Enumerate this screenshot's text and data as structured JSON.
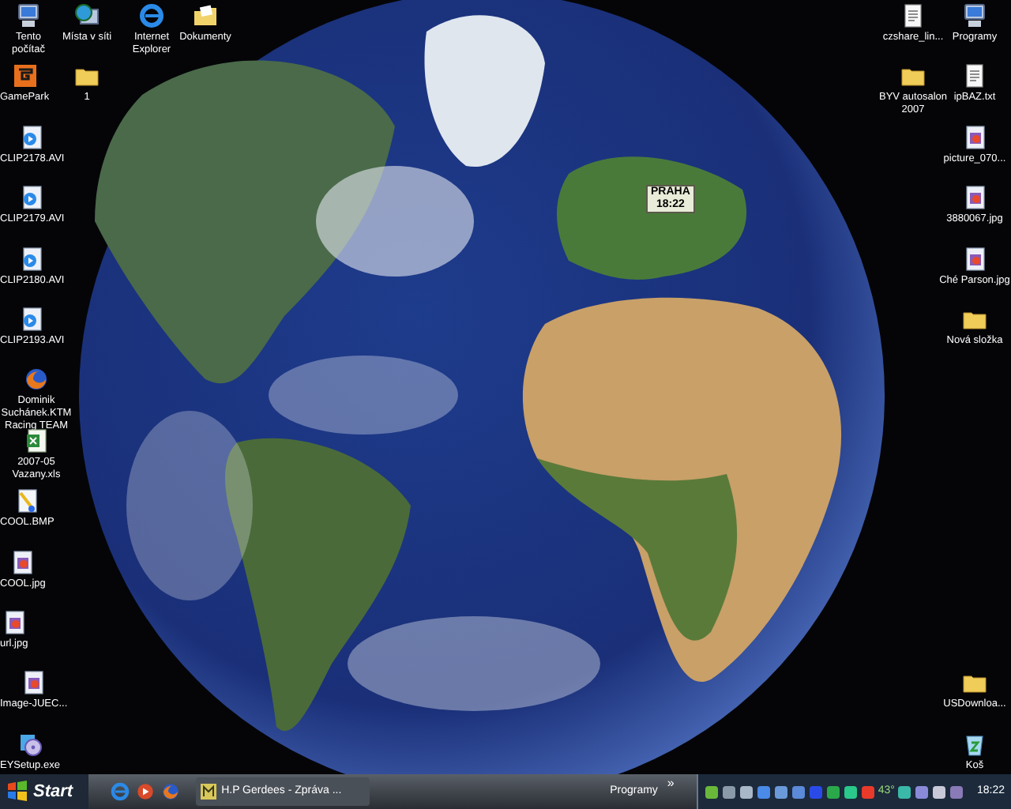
{
  "desktop_icons_left": [
    {
      "label": "Tento počítač",
      "kind": "computer"
    },
    {
      "label": "Místa v síti",
      "kind": "network"
    },
    {
      "label": "Internet Explorer",
      "kind": "browser"
    },
    {
      "label": "Dokumenty",
      "kind": "documents"
    },
    {
      "label": "GamePark",
      "kind": "game"
    },
    {
      "label": "1",
      "kind": "folder"
    },
    {
      "label": "CLIP2178.AVI",
      "kind": "video"
    },
    {
      "label": "CLIP2179.AVI",
      "kind": "video"
    },
    {
      "label": "CLIP2180.AVI",
      "kind": "video"
    },
    {
      "label": "CLIP2193.AVI",
      "kind": "video"
    },
    {
      "label": "Dominik Suchánek.KTM Racing TEAM",
      "kind": "firefox"
    },
    {
      "label": "2007-05 Vazany.xls",
      "kind": "spreadsheet"
    },
    {
      "label": "COOL.BMP",
      "kind": "paint"
    },
    {
      "label": "COOL.jpg",
      "kind": "image"
    },
    {
      "label": "url.jpg",
      "kind": "image"
    },
    {
      "label": "Image-JUEC...",
      "kind": "image"
    },
    {
      "label": "EYSetup.exe",
      "kind": "setup"
    }
  ],
  "desktop_icons_right": [
    {
      "label": "czshare_lin...",
      "kind": "text"
    },
    {
      "label": "Programy",
      "kind": "computer"
    },
    {
      "label": "BYV autosalon 2007",
      "kind": "folder"
    },
    {
      "label": "ipBAZ.txt",
      "kind": "text"
    },
    {
      "label": "picture_070...",
      "kind": "image"
    },
    {
      "label": "3880067.jpg",
      "kind": "image"
    },
    {
      "label": "Ché Parson.jpg",
      "kind": "image"
    },
    {
      "label": "Nová složka",
      "kind": "folder"
    },
    {
      "label": "USDownloa...",
      "kind": "folder"
    },
    {
      "label": "Koš",
      "kind": "recycle"
    }
  ],
  "city_clock": {
    "city": "PRAHA",
    "time": "18:22"
  },
  "taskbar": {
    "start": "Start",
    "quick_launch": [
      {
        "kind": "browser"
      },
      {
        "kind": "media"
      },
      {
        "kind": "firefox"
      }
    ],
    "tasks": [
      {
        "label": "H.P Gerdees - Zpráva ...",
        "selected": false
      }
    ],
    "toolbar": {
      "label": "Programy",
      "chevron": "»"
    },
    "tray": {
      "temperature": "43°",
      "clock": "18:22"
    }
  }
}
